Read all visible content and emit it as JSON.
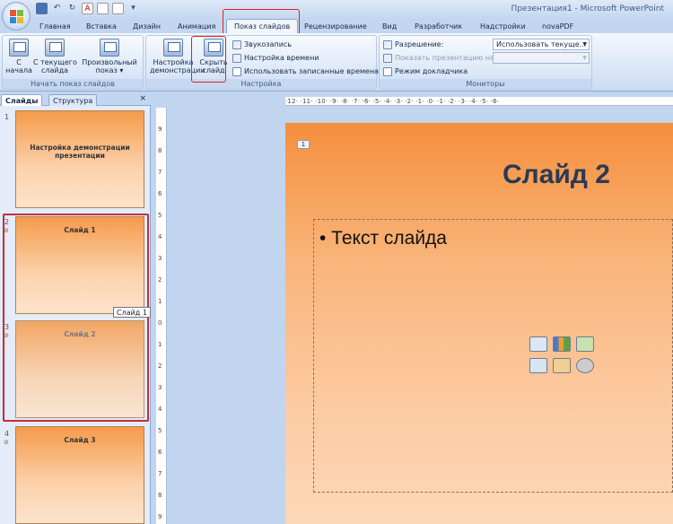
{
  "window": {
    "title": "Презентация1 - Microsoft PowerPoint"
  },
  "ribbon_tabs": [
    "Главная",
    "Вставка",
    "Дизайн",
    "Анимация",
    "Показ слайдов",
    "Рецензирование",
    "Вид",
    "Разработчик",
    "Надстройки",
    "novaPDF"
  ],
  "active_tab": "Показ слайдов",
  "groups": {
    "start": {
      "label": "Начать показ слайдов",
      "from_start": "С\nначала",
      "from_current": "С текущего\nслайда",
      "custom": "Произвольный\nпоказ ▾"
    },
    "setup": {
      "label": "Настройка",
      "setup_show": "Настройка\nдемонстрации",
      "hide_slide": "Скрыть\nслайд",
      "record_narration": "Звукозапись",
      "rehearse_timings": "Настройка времени",
      "use_timings": "Использовать записанные времена"
    },
    "monitors": {
      "label": "Мониторы",
      "resolution_label": "Разрешение:",
      "resolution_value": "Использовать текуще...",
      "show_on_label": "Показать презентацию на:",
      "show_on_value": "",
      "presenter_view": "Режим докладчика"
    }
  },
  "panel": {
    "tab_slides": "Слайды",
    "tab_outline": "Структура",
    "close": "×",
    "slides": [
      {
        "num": "1",
        "title": "Настройка демонстрации презентации",
        "hidden": false
      },
      {
        "num": "2",
        "title": "Слайд 1",
        "hidden": true
      },
      {
        "num": "3",
        "title": "Слайд 2",
        "hidden": true
      },
      {
        "num": "4",
        "title": "Слайд 3",
        "hidden": true
      }
    ],
    "tooltip": "Слайд 1"
  },
  "ruler": {
    "horizontal": "·12· ·11· ·10· ·9· ·8· ·7· ·6· ·5· ·4· ·3· ·2· ·1· ·0· ·1· ·2· ·3· ·4· ·5· ·6·",
    "vertical": [
      "9",
      "8",
      "7",
      "6",
      "5",
      "4",
      "3",
      "2",
      "1",
      "0",
      "1",
      "2",
      "3",
      "4",
      "5",
      "6",
      "7",
      "8",
      "9"
    ]
  },
  "slide": {
    "number": "1",
    "title": "Слайд 2",
    "bullet": "• Текст слайда"
  }
}
